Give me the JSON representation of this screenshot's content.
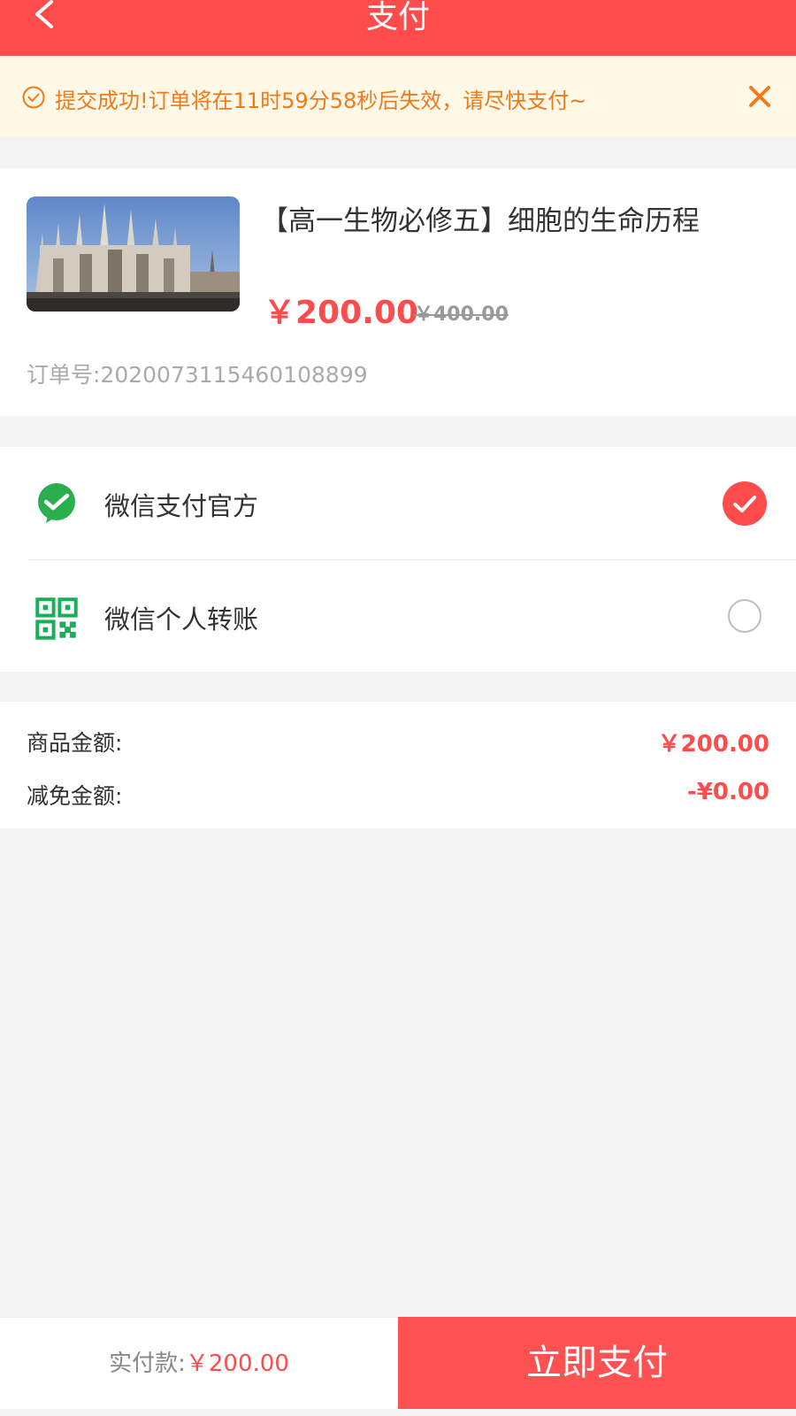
{
  "header": {
    "title": "支付",
    "back_icon": "chevron-left-icon",
    "background_color": "#fe4b4b"
  },
  "notice": {
    "icon": "check-circle-icon",
    "text": "提交成功!订单将在11时59分58秒后失效，请尽快支付~",
    "close_icon": "close-icon",
    "text_color": "#f07a1a",
    "background_color": "#fdf9e6"
  },
  "product": {
    "title": "【高一生物必修五】细胞的生命历程",
    "price": "￥200.00",
    "original_price": "￥400.00",
    "order_number": "订单号:2020073115460108899",
    "image": "cathedral-photo"
  },
  "payment_methods": [
    {
      "label": "微信支付官方",
      "icon": "wechat-pay-icon",
      "selected": true
    },
    {
      "label": "微信个人转账",
      "icon": "qr-code-icon",
      "selected": false
    }
  ],
  "amounts": {
    "goods_label": "商品金额:",
    "goods_value": "￥200.00",
    "discount_label": "减免金额:",
    "discount_value": "-¥0.00"
  },
  "footer": {
    "total_label": "实付款:",
    "total_value": "￥200.00",
    "pay_button": "立即支付"
  },
  "colors": {
    "accent": "#fe4b4b",
    "wechat_green": "#2aae4e",
    "qr_green": "#1aad5a"
  }
}
